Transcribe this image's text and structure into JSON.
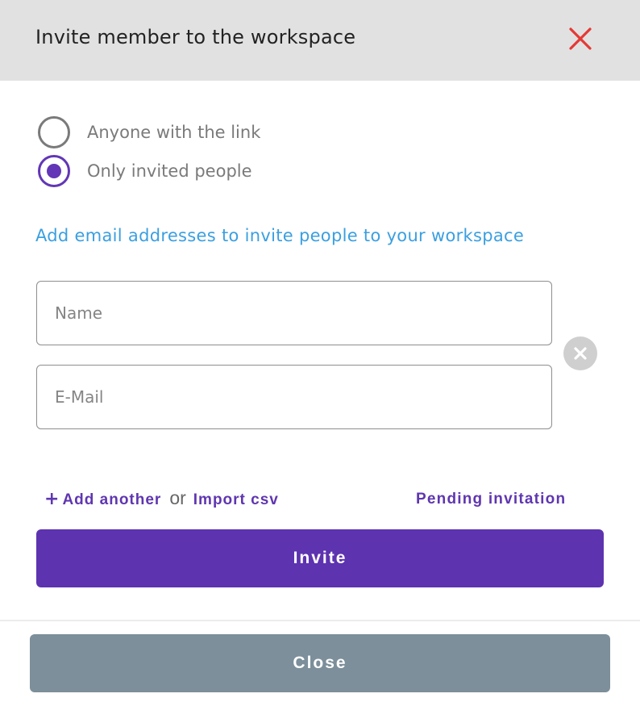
{
  "dialog": {
    "title": "Invite member to the workspace",
    "close_icon": "close-x-icon",
    "close_icon_color": "#e53935"
  },
  "access": {
    "options": [
      {
        "label": "Anyone with the link",
        "selected": false
      },
      {
        "label": "Only invited people",
        "selected": true
      }
    ],
    "selected_color": "#6236b6"
  },
  "hint": "Add email addresses to invite people to your workspace",
  "form": {
    "name_placeholder": "Name",
    "email_placeholder": "E-Mail",
    "name_value": "",
    "email_value": "",
    "remove_icon": "remove-circle-icon"
  },
  "links": {
    "plus": "+",
    "add_another": "Add another",
    "or": "or",
    "import_csv": "Import csv",
    "pending_invitation": "Pending invitation"
  },
  "buttons": {
    "invite": "Invite",
    "close": "Close"
  },
  "colors": {
    "accent": "#5d33b0",
    "link": "#3b9fe0",
    "close_button": "#7c8f9a",
    "header_bg": "#e1e1e1"
  }
}
